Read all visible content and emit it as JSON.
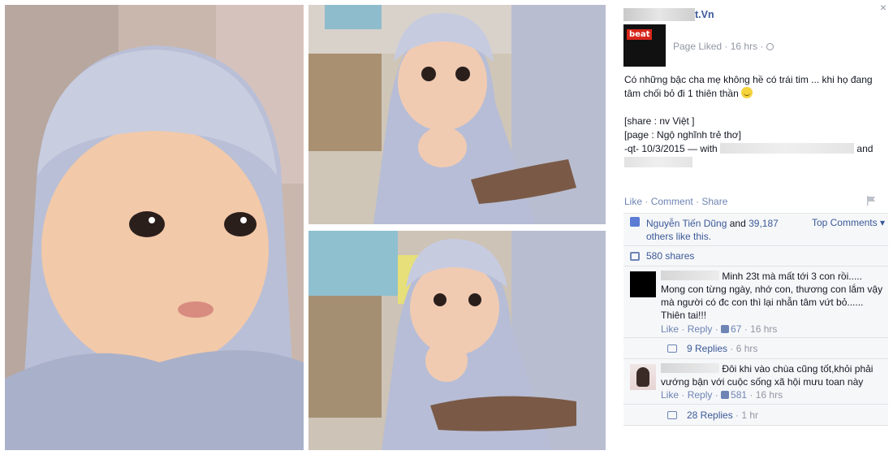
{
  "close_label": "×",
  "post": {
    "page_name_suffix": "t.Vn",
    "logo_text": "beat",
    "meta": "Page Liked · 16 hrs ·",
    "line1": "Có những bậc cha mẹ không hề có trái tim ... khi họ đang tâm chối bỏ đi 1 thiên thần",
    "line2": "[share : nv Việt ]",
    "line3": "[page : Ngộ nghĩnh trẻ thơ]",
    "line4": "-qt- 10/3/2015 — with",
    "and_label": "and"
  },
  "actions": {
    "like": "Like",
    "comment": "Comment",
    "share": "Share",
    "sep": " · "
  },
  "ufi": {
    "likes_name": "Nguyễn Tiến Dũng",
    "likes_rest": " and ",
    "likes_count": "39,187",
    "likes_others": "others like this.",
    "top_comments": "Top Comments ▾",
    "shares": "580 shares"
  },
  "comments": [
    {
      "text_start": "Minh 23t mà mất tới 3 con rồi..... Mong con từng ngày, nhớ con, thương con lắm vậy mà người có đc con thì lại nhẫn tâm vứt bỏ...... Thiên tai!!!",
      "like": "Like",
      "reply": "Reply",
      "likes": "67",
      "time": "16 hrs",
      "replies": "9 Replies",
      "replies_time": "· 6 hrs"
    },
    {
      "text_start": "Đôi khi vào chùa cũng tốt,khỏi phải vướng bận với cuộc sống xã hội mưu toan này",
      "like": "Like",
      "reply": "Reply",
      "likes": "581",
      "time": "16 hrs",
      "replies": "28 Replies",
      "replies_time": "· 1 hr"
    }
  ],
  "colors": {
    "link": "#3b5998",
    "meta": "#9197a3",
    "panel_bg": "#f6f7f9",
    "robe": "#c3c8de"
  },
  "icons": [
    "close-icon",
    "globe-icon",
    "smiley-icon",
    "flag-icon",
    "like-thumb-icon",
    "share-icon",
    "reply-icon"
  ]
}
